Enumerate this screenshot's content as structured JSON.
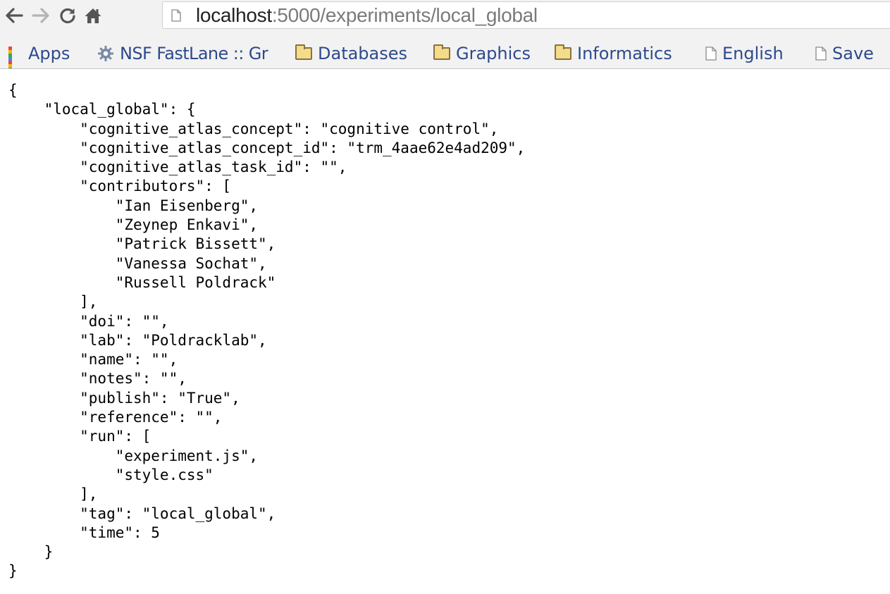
{
  "browser": {
    "nav_icons": [
      "back-arrow-icon",
      "forward-arrow-icon",
      "reload-icon",
      "home-icon",
      "page-icon"
    ],
    "url": {
      "host": "localhost",
      "rest": ":5000/experiments/local_global"
    }
  },
  "bookmarks": [
    {
      "label": "Apps",
      "icon": "apps-grid-icon"
    },
    {
      "label": "NSF FastLane :: Gr",
      "icon": "gear-icon"
    },
    {
      "label": "Databases",
      "icon": "folder-icon"
    },
    {
      "label": "Graphics",
      "icon": "folder-icon"
    },
    {
      "label": "Informatics",
      "icon": "folder-icon"
    },
    {
      "label": "English",
      "icon": "page-icon"
    },
    {
      "label": "Save",
      "icon": "page-icon"
    }
  ],
  "json_lines": [
    "{",
    "    \"local_global\": {",
    "        \"cognitive_atlas_concept\": \"cognitive control\",",
    "        \"cognitive_atlas_concept_id\": \"trm_4aae62e4ad209\",",
    "        \"cognitive_atlas_task_id\": \"\",",
    "        \"contributors\": [",
    "            \"Ian Eisenberg\",",
    "            \"Zeynep Enkavi\",",
    "            \"Patrick Bissett\",",
    "            \"Vanessa Sochat\",",
    "            \"Russell Poldrack\"",
    "        ],",
    "        \"doi\": \"\",",
    "        \"lab\": \"Poldracklab\",",
    "        \"name\": \"\",",
    "        \"notes\": \"\",",
    "        \"publish\": \"True\",",
    "        \"reference\": \"\",",
    "        \"run\": [",
    "            \"experiment.js\",",
    "            \"style.css\"",
    "        ],",
    "        \"tag\": \"local_global\",",
    "        \"time\": 5",
    "    }",
    "}"
  ],
  "colors": {
    "bookmark_text": "#2d4a8c",
    "toolbar_bg": "#f2f2f2",
    "url_host": "#222222",
    "url_path": "#7a7a7a"
  }
}
